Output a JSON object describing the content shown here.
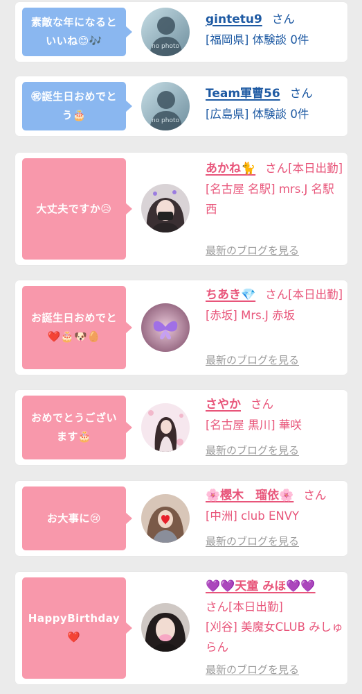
{
  "colors": {
    "member_bubble": "#8ab7f0",
    "cast_bubble": "#f898ab",
    "member_text": "#1e5aa3",
    "cast_text": "#e8557a",
    "blog_link": "#9b9b9b",
    "page_bg": "#ebebeb"
  },
  "posts": [
    {
      "message": "素敵な年になるといいね😊🎶",
      "name": "gintetu9",
      "honorific": "さん",
      "detail": "[福岡県] 体験談 0件",
      "avatar_text": "no photo",
      "type": "member"
    },
    {
      "message": "㊗誕生日おめでとう🎂",
      "name": "Team軍曹56",
      "honorific": "さん",
      "detail": "[広島県] 体験談 0件",
      "avatar_text": "no photo",
      "type": "member"
    },
    {
      "message": "大丈夫ですか😥",
      "name": "あかね🐈",
      "honorific": "さん[本日出勤]",
      "detail": "[名古屋 名駅] mrs.J 名駅西",
      "blog_link": "最新のブログを見る",
      "type": "cast"
    },
    {
      "message": "お誕生日おめでと❤️🎂🐶🥚",
      "name": "ちあき💎",
      "honorific": "さん[本日出勤]",
      "detail": "[赤坂] Mrs.J 赤坂",
      "blog_link": "最新のブログを見る",
      "type": "cast"
    },
    {
      "message": "おめでとうございます🎂",
      "name": "さやか",
      "honorific": "さん",
      "detail": "[名古屋 黒川] 華咲",
      "blog_link": "最新のブログを見る",
      "type": "cast"
    },
    {
      "message": "お大事に😢",
      "name": "🌸櫻木　瑠依🌸",
      "honorific": "さん",
      "detail": "[中洲] club ENVY",
      "blog_link": "最新のブログを見る",
      "type": "cast"
    },
    {
      "message": "HappyBirthday❤️",
      "name": "💜💜天童 みほ💜💜",
      "honorific": "さん[本日出勤]",
      "detail": "[刈谷] 美魔女CLUB みしゅらん",
      "blog_link": "最新のブログを見る",
      "type": "cast"
    }
  ]
}
